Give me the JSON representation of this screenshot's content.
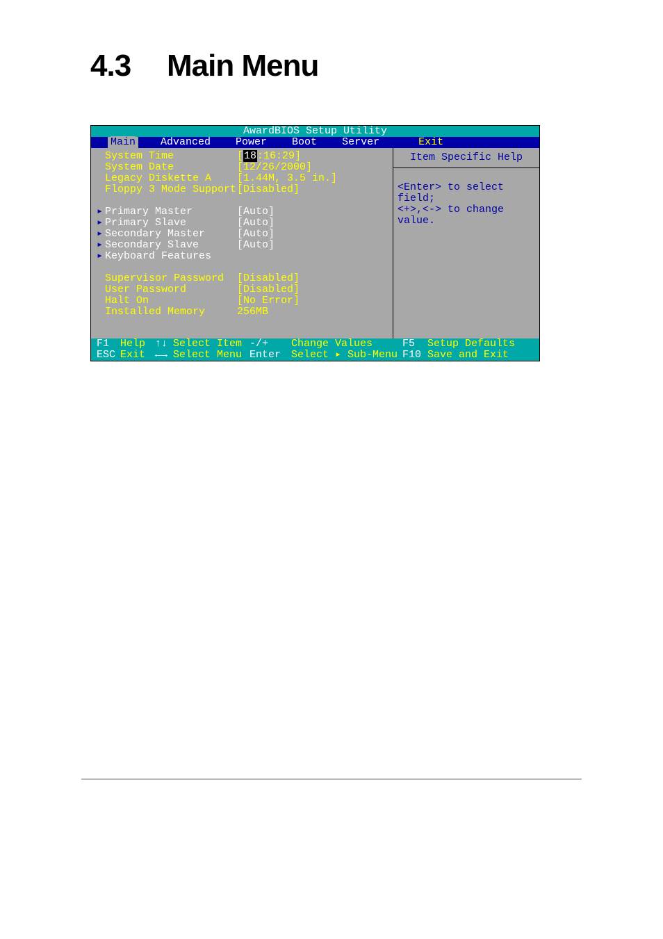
{
  "heading": {
    "num": "4.3",
    "title": "Main Menu"
  },
  "bios": {
    "title": "AwardBIOS Setup Utility",
    "menu": {
      "items": [
        "Main",
        "Advanced",
        "Power",
        "Boot",
        "Server",
        "Exit"
      ],
      "selected": "Main"
    },
    "settings": {
      "group1": [
        {
          "label": "System Time",
          "value_prefix": "[",
          "cursor": "18",
          "value_suffix": ":16:29]"
        },
        {
          "label": "System Date",
          "value": "[12/26/2000]"
        },
        {
          "label": "Legacy Diskette A",
          "value": "[1.44M, 3.5 in.]"
        },
        {
          "label": "Floppy 3 Mode Support",
          "value": "[Disabled]"
        }
      ],
      "submenus": [
        {
          "label": "Primary Master",
          "value": "[Auto]"
        },
        {
          "label": "Primary Slave",
          "value": "[Auto]"
        },
        {
          "label": "Secondary Master",
          "value": "[Auto]"
        },
        {
          "label": "Secondary Slave",
          "value": "[Auto]"
        },
        {
          "label": "Keyboard Features",
          "value": ""
        }
      ],
      "group3": [
        {
          "label": "Supervisor Password",
          "value": "[Disabled]"
        },
        {
          "label": "User Password",
          "value": "[Disabled]"
        },
        {
          "label": "Halt On",
          "value": "[No Error]"
        },
        {
          "label": "Installed Memory",
          "value": "256MB"
        }
      ]
    },
    "help": {
      "title": "Item Specific Help",
      "line1": "<Enter> to select field;",
      "line2": "<+>,<-> to change value."
    },
    "footer": {
      "r1": {
        "k1": "F1",
        "a1": "Help",
        "k2": "↑↓",
        "a2": "Select Item",
        "k3": "-/+",
        "a3": "Change Values",
        "k4": "F5",
        "a4": "Setup Defaults"
      },
      "r2": {
        "k1": "ESC",
        "a1": "Exit",
        "k2": "←→",
        "a2": "Select Menu",
        "k3": "Enter",
        "a3": "Select ▸ Sub-Menu",
        "k4": "F10",
        "a4": "Save and Exit"
      }
    }
  }
}
